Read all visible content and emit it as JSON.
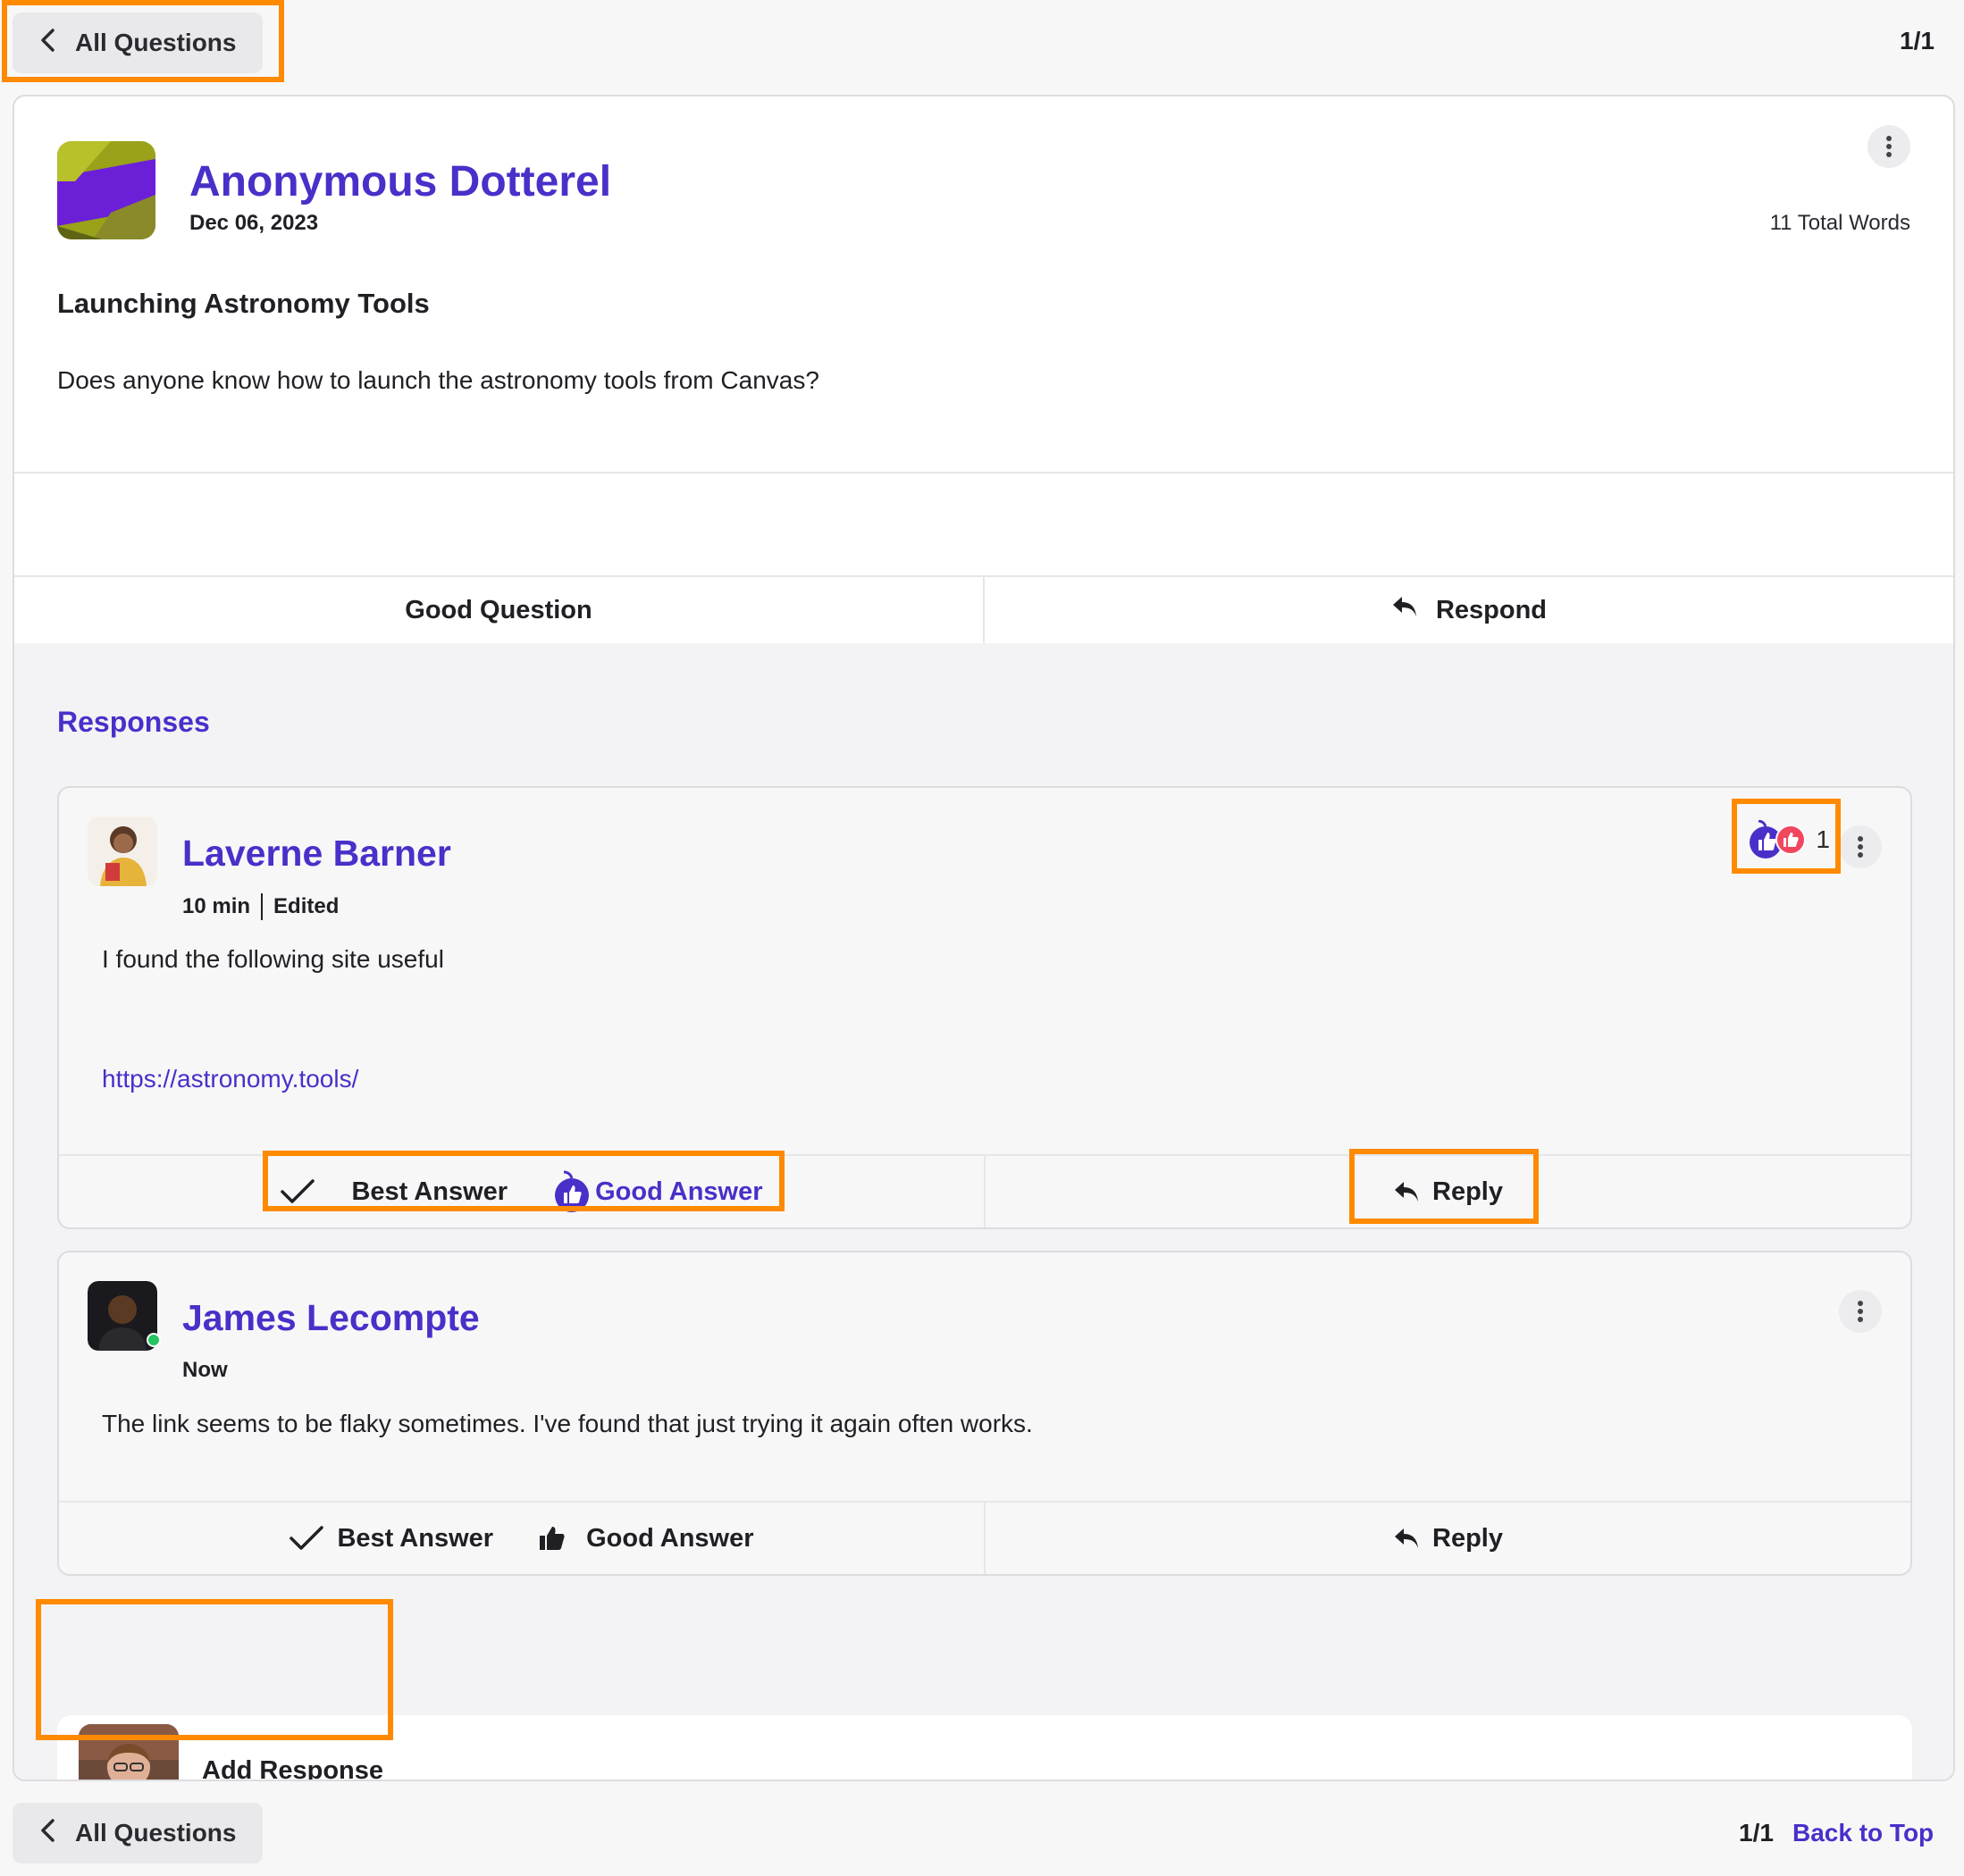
{
  "nav": {
    "back_label": "All Questions",
    "pager": "1/1",
    "back_to_top": "Back to Top"
  },
  "question": {
    "author": "Anonymous Dotterel",
    "date": "Dec 06, 2023",
    "word_count": "11 Total Words",
    "title": "Launching Astronomy Tools",
    "body": "Does anyone know how to launch the astronomy tools from Canvas?",
    "good_question_label": "Good Question",
    "respond_label": "Respond"
  },
  "responses": {
    "title": "Responses",
    "items": [
      {
        "author": "Laverne Barner",
        "time": "10 min",
        "edited": "Edited",
        "body": "I found the following site useful",
        "link": "https://astronomy.tools/",
        "reaction_count": "1",
        "best_label": "Best Answer",
        "good_label": "Good Answer",
        "reply_label": "Reply"
      },
      {
        "author": "James Lecompte",
        "time": "Now",
        "online": true,
        "body": "The link seems to be flaky sometimes. I've found that just trying it again often works.",
        "best_label": "Best Answer",
        "good_label": "Good Answer",
        "reply_label": "Reply"
      }
    ]
  },
  "add_response": {
    "label": "Add Response"
  },
  "colors": {
    "accent": "#4a2fc9",
    "highlight": "#ff8a00",
    "reaction_red": "#f0475e",
    "online": "#22c55e"
  }
}
